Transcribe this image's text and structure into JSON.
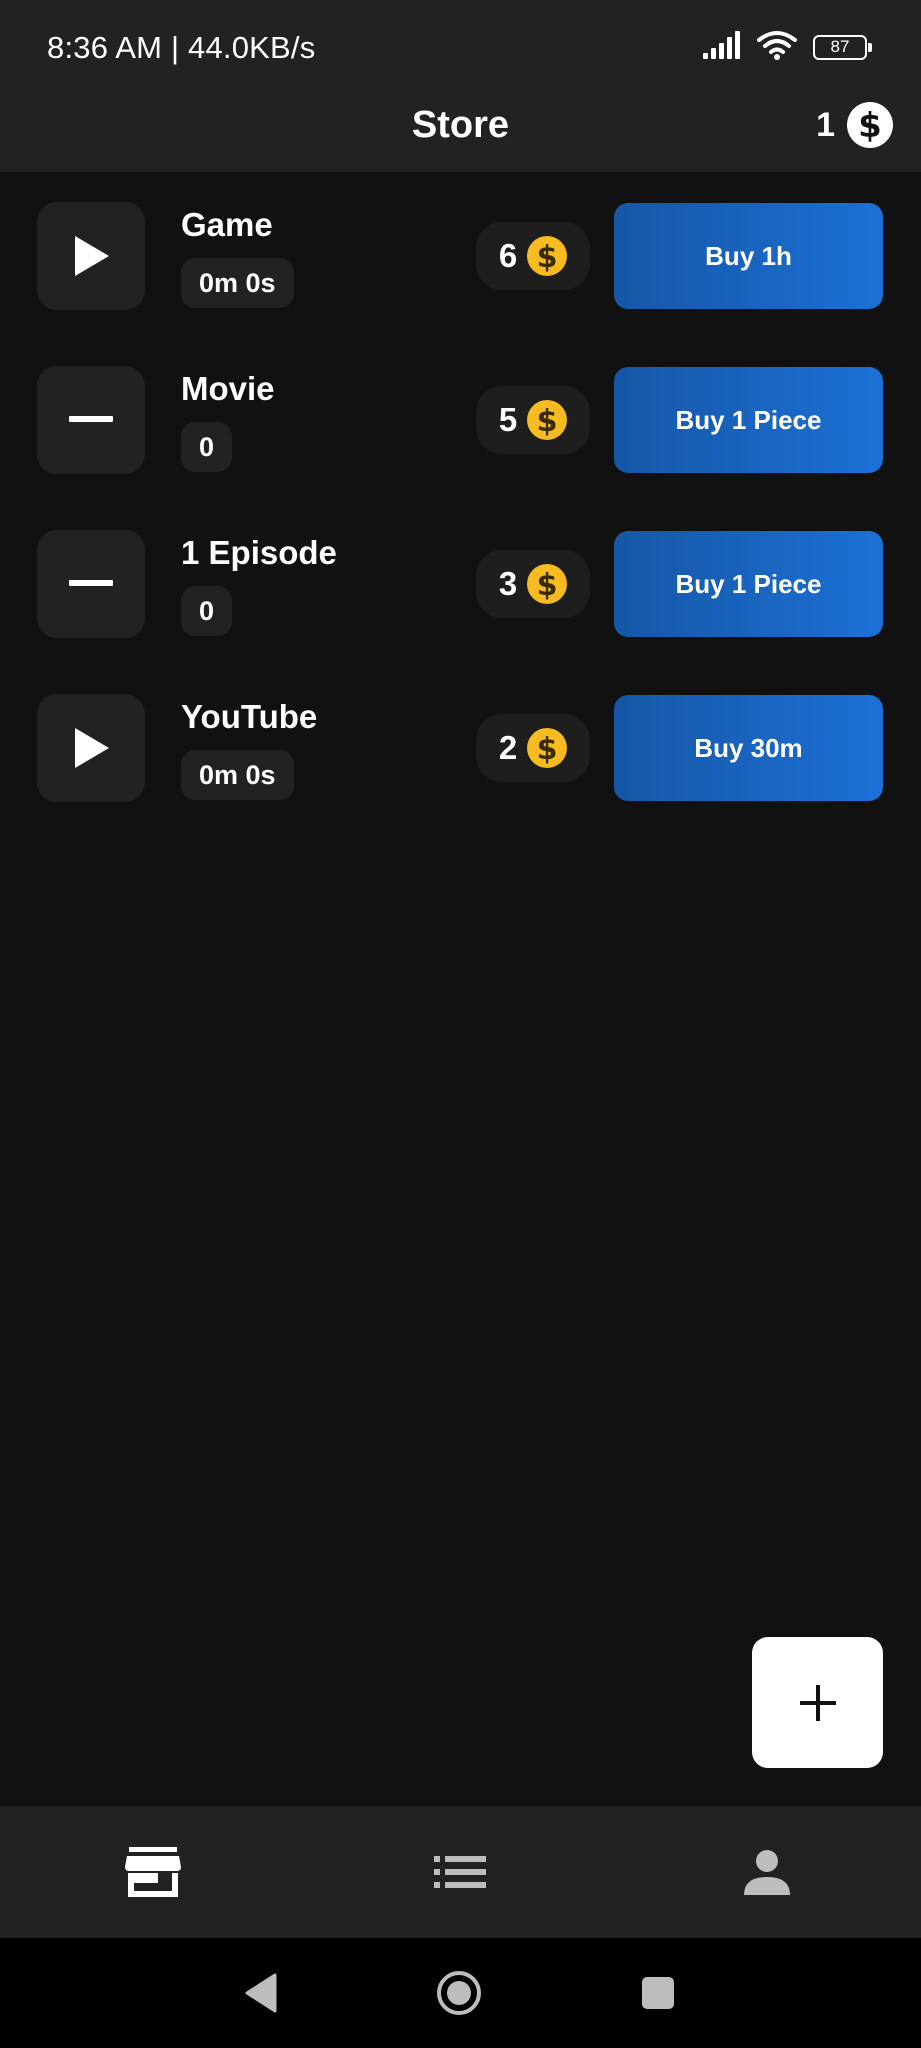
{
  "status_bar": {
    "time_speed": "8:36 AM | 44.0KB/s",
    "battery": "87",
    "icons": [
      "signal-icon",
      "wifi-icon",
      "battery-icon"
    ]
  },
  "app_bar": {
    "title": "Store",
    "balance": "1",
    "balance_icon": "dollar-coin-icon"
  },
  "colors": {
    "background": "#111111",
    "surface": "#222222",
    "button_gradient_start": "#1657a6",
    "button_gradient_end": "#1c70d6",
    "coin": "#f5bb20"
  },
  "store_items": [
    {
      "name": "Game",
      "meta": "0m 0s",
      "price": "6",
      "buy_label": "Buy 1h",
      "icon": "play-icon"
    },
    {
      "name": "Movie",
      "meta": "0",
      "price": "5",
      "buy_label": "Buy 1 Piece",
      "icon": "minus-icon"
    },
    {
      "name": "1 Episode",
      "meta": "0",
      "price": "3",
      "buy_label": "Buy 1 Piece",
      "icon": "minus-icon"
    },
    {
      "name": "YouTube",
      "meta": "0m 0s",
      "price": "2",
      "buy_label": "Buy 30m",
      "icon": "play-icon"
    }
  ],
  "fab": {
    "icon": "plus-icon"
  },
  "bottom_nav": {
    "items": [
      {
        "icon": "store-icon",
        "selected": true
      },
      {
        "icon": "list-icon",
        "selected": false
      },
      {
        "icon": "person-icon",
        "selected": false
      }
    ]
  },
  "system_nav": {
    "items": [
      "back-icon",
      "home-icon",
      "recents-icon"
    ]
  }
}
